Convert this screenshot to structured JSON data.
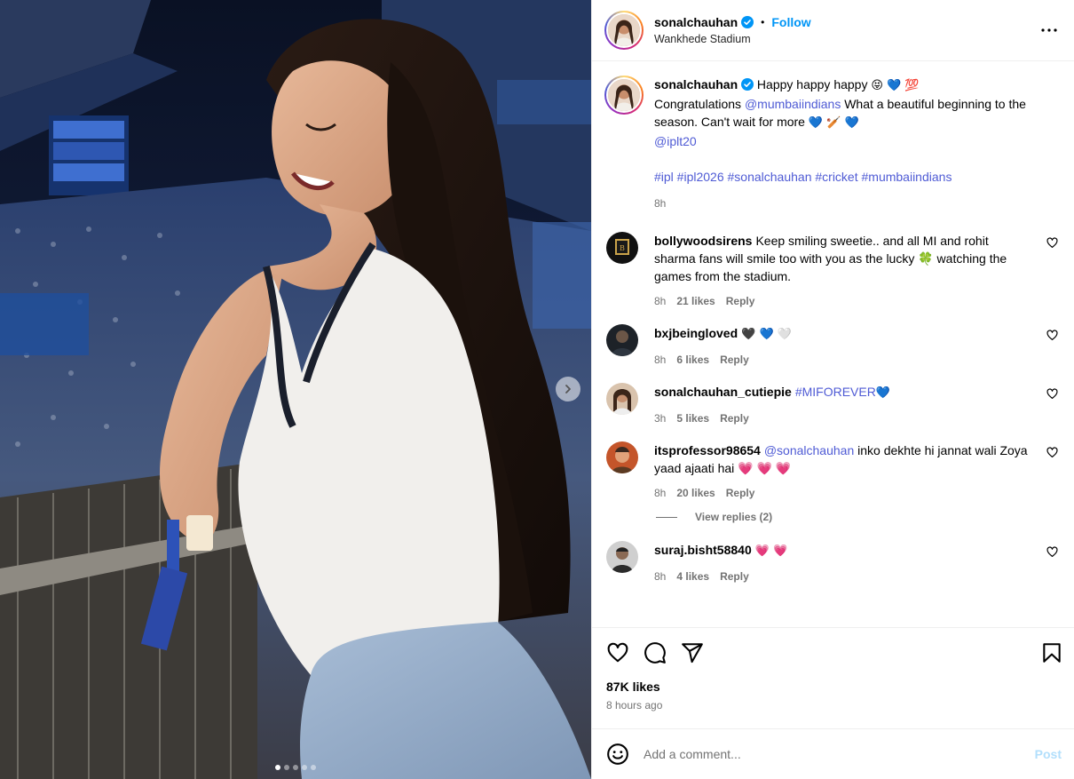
{
  "post": {
    "username": "sonalchauhan",
    "follow_label": "Follow",
    "separator": "•",
    "location": "Wankhede Stadium",
    "caption": {
      "intro": "Happy happy happy",
      "intro_emojis": "😝 💙 💯",
      "line2_before": "Congratulations ",
      "mention1": "@mumbaiindians",
      "line2_after": " What a beautiful beginning to the season. Can't wait for more ",
      "line2_emojis": "💙 🏏 💙",
      "mention2": "@iplt20",
      "hashtags": "#ipl #ipl2026 #sonalchauhan #cricket #mumbaiindians",
      "time": "8h"
    },
    "likes": "87K likes",
    "posted": "8 hours ago"
  },
  "comments": [
    {
      "user": "bollywoodsirens",
      "text": "Keep smiling sweetie.. and all MI and rohit sharma fans will smile too with you as the lucky 🍀 watching the games from the stadium.",
      "time": "8h",
      "likes": "21 likes",
      "reply": "Reply"
    },
    {
      "user": "bxjbeingloved",
      "text": "🖤 💙 🤍",
      "time": "8h",
      "likes": "6 likes",
      "reply": "Reply"
    },
    {
      "user": "sonalchauhan_cutiepie",
      "tag": "#MIFOREVER",
      "text": "💙",
      "time": "3h",
      "likes": "5 likes",
      "reply": "Reply"
    },
    {
      "user": "itsprofessor98654",
      "tag": "@sonalchauhan",
      "text": " inko dekhte hi jannat wali Zoya yaad ajaati hai 💗 💗 💗",
      "time": "8h",
      "likes": "20 likes",
      "reply": "Reply",
      "view_replies": "View replies (2)"
    },
    {
      "user": "suraj.bisht58840",
      "text": "💗 💗",
      "time": "8h",
      "likes": "4 likes",
      "reply": "Reply"
    }
  ],
  "comment_box": {
    "placeholder": "Add a comment...",
    "post_label": "Post"
  },
  "carousel": {
    "slide_count": 5,
    "active_index": 0
  },
  "colors": {
    "link_blue": "#4f5bd5",
    "follow_blue": "#0095f6",
    "post_disabled": "#b2dffc",
    "muted": "#737373"
  },
  "icons": [
    "verified-badge-icon",
    "more-options-icon",
    "heart-icon",
    "comment-icon",
    "share-icon",
    "bookmark-icon",
    "emoji-icon",
    "chevron-right-icon"
  ]
}
